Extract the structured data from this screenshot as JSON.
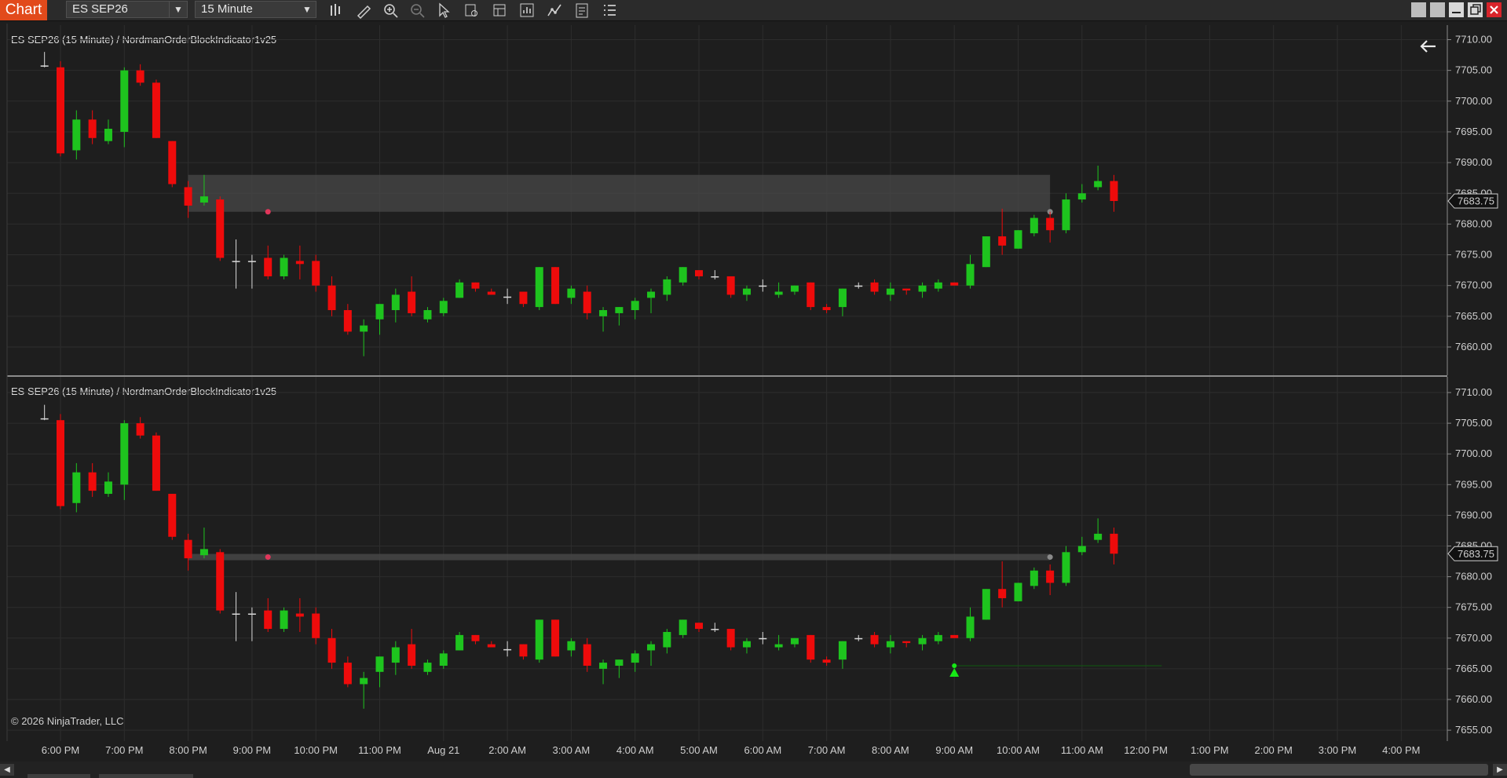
{
  "toolbar": {
    "chart_tab": "Chart",
    "instrument": "ES SEP26",
    "interval": "15 Minute",
    "tools": [
      "bar-type-icon",
      "draw-pencil-icon",
      "zoom-in-icon",
      "zoom-out-icon",
      "cursor-arrow-icon",
      "data-box-icon",
      "templates-icon",
      "strategies-icon",
      "indicators-icon",
      "properties-icon",
      "list-icon"
    ]
  },
  "window": {
    "controls": [
      "tile-icon",
      "tile-icon",
      "minimize-icon",
      "restore-icon",
      "close-icon"
    ]
  },
  "colors": {
    "up": "#1ec41e",
    "down": "#ee0b0b",
    "doji": "#d8d8d8",
    "accent": "#e24a1b",
    "zone": "#484848",
    "marker": "#e0365a",
    "signal": "#16e816"
  },
  "panels": [
    {
      "label": "ES SEP26 (15 Minute) / NordmanOrderBlockIndicator1v25",
      "last_price": "7683.75",
      "zone": {
        "kind": "box",
        "start_time": "8:00 PM",
        "end_time": "9:30 AM",
        "top": 7688.0,
        "bottom": 7682.0
      }
    },
    {
      "label": "ES SEP26 (15 Minute) / NordmanOrderBlockIndicator1v25",
      "last_price": "7683.75",
      "zone": {
        "kind": "line",
        "start_time": "8:00 PM",
        "end_time": "9:30 AM",
        "level": 7683.2
      }
    }
  ],
  "price_axis": [
    "7710.00",
    "7705.00",
    "7700.00",
    "7695.00",
    "7690.00",
    "7685.00",
    "7680.00",
    "7675.00",
    "7670.00",
    "7665.00",
    "7660.00"
  ],
  "bottom_axis_extra": "7655.00",
  "time_axis": [
    "6:00 PM",
    "7:00 PM",
    "8:00 PM",
    "9:00 PM",
    "10:00 PM",
    "11:00 PM",
    "Aug 21",
    "2:00 AM",
    "3:00 AM",
    "4:00 AM",
    "5:00 AM",
    "6:00 AM",
    "7:00 AM",
    "8:00 AM",
    "9:00 AM",
    "10:00 AM",
    "11:00 AM",
    "12:00 PM",
    "1:00 PM",
    "2:00 PM",
    "3:00 PM",
    "4:00 PM"
  ],
  "copyright": "© 2026 NinjaTrader, LLC",
  "chart_data": {
    "type": "candlestick",
    "instrument": "ES SEP26",
    "interval": "15 Minute",
    "first_bar_time": "5:45 PM",
    "ylim": [
      7657,
      7711
    ],
    "bars": [
      [
        7705.8,
        7708,
        7705.5,
        7705.8
      ],
      [
        7705.5,
        7706.5,
        7691,
        7691.5
      ],
      [
        7692,
        7698.5,
        7690.5,
        7697
      ],
      [
        7697,
        7698.5,
        7693,
        7694
      ],
      [
        7693.5,
        7697,
        7693,
        7695.5
      ],
      [
        7695,
        7705.5,
        7692.5,
        7705
      ],
      [
        7705,
        7706,
        7702.5,
        7703
      ],
      [
        7703,
        7703.5,
        7694,
        7694
      ],
      [
        7693.5,
        7693.5,
        7686,
        7686.5
      ],
      [
        7686,
        7687,
        7681,
        7683
      ],
      [
        7683.5,
        7688,
        7683,
        7684.5
      ],
      [
        7684,
        7684.5,
        7674,
        7674.5
      ],
      [
        7674,
        7677.5,
        7669.5,
        7674
      ],
      [
        7674,
        7675,
        7669.5,
        7674
      ],
      [
        7674.5,
        7676.5,
        7671,
        7671.5
      ],
      [
        7671.5,
        7675,
        7671,
        7674.5
      ],
      [
        7674,
        7676.5,
        7671,
        7673.5
      ],
      [
        7674,
        7675,
        7669,
        7670
      ],
      [
        7670,
        7671.5,
        7665,
        7666
      ],
      [
        7666,
        7667,
        7662,
        7662.5
      ],
      [
        7662.5,
        7664.5,
        7658.5,
        7663.5
      ],
      [
        7664.5,
        7667,
        7662,
        7667
      ],
      [
        7666,
        7669.5,
        7664,
        7668.5
      ],
      [
        7669,
        7671.5,
        7665,
        7665.5
      ],
      [
        7664.5,
        7666.5,
        7664,
        7666
      ],
      [
        7665.5,
        7668,
        7665,
        7667.5
      ],
      [
        7668,
        7671,
        7668,
        7670.5
      ],
      [
        7670.5,
        7670.5,
        7669,
        7669.5
      ],
      [
        7669,
        7669.5,
        7668.5,
        7668.5
      ],
      [
        7668.2,
        7669.5,
        7667,
        7668.2
      ],
      [
        7669,
        7669,
        7666.5,
        7667
      ],
      [
        7666.5,
        7673,
        7666,
        7673
      ],
      [
        7673,
        7673,
        7667,
        7667
      ],
      [
        7668,
        7670,
        7667,
        7669.5
      ],
      [
        7669,
        7670,
        7664.5,
        7665.5
      ],
      [
        7665,
        7666.5,
        7662.5,
        7666
      ],
      [
        7665.5,
        7666.5,
        7663.5,
        7666.5
      ],
      [
        7666,
        7668,
        7664.5,
        7667.5
      ],
      [
        7668,
        7669.5,
        7665.5,
        7669
      ],
      [
        7668.5,
        7671.5,
        7667.5,
        7671
      ],
      [
        7670.5,
        7673,
        7670,
        7673
      ],
      [
        7672.5,
        7672.5,
        7671,
        7671.5
      ],
      [
        7671.5,
        7672.5,
        7671,
        7671.5
      ],
      [
        7671.5,
        7671.5,
        7668,
        7668.5
      ],
      [
        7668.5,
        7670,
        7667.5,
        7669.5
      ],
      [
        7670,
        7671,
        7669,
        7670
      ],
      [
        7668.5,
        7670.5,
        7668,
        7669
      ],
      [
        7669,
        7670,
        7668.5,
        7670
      ],
      [
        7670.5,
        7670.5,
        7666,
        7666.5
      ],
      [
        7666.5,
        7667,
        7665.5,
        7666
      ],
      [
        7666.5,
        7669.5,
        7665,
        7669.5
      ],
      [
        7670,
        7670.5,
        7669.5,
        7670
      ],
      [
        7670.5,
        7671,
        7668.5,
        7669
      ],
      [
        7668.5,
        7670.5,
        7667.5,
        7669.5
      ],
      [
        7669.5,
        7669.5,
        7668.5,
        7669.2
      ],
      [
        7669,
        7670.5,
        7668,
        7670
      ],
      [
        7669.5,
        7671,
        7669,
        7670.5
      ],
      [
        7670.5,
        7670.5,
        7670,
        7670
      ],
      [
        7670,
        7675,
        7669.5,
        7673.5
      ],
      [
        7673,
        7678,
        7673,
        7678
      ],
      [
        7678,
        7682.5,
        7675,
        7676.5
      ],
      [
        7676,
        7679,
        7676,
        7679
      ],
      [
        7678.5,
        7681.5,
        7678,
        7681
      ],
      [
        7681,
        7682,
        7677,
        7679
      ],
      [
        7679,
        7685,
        7678.5,
        7684
      ],
      [
        7684,
        7686.5,
        7683.5,
        7685
      ],
      [
        7686,
        7689.5,
        7685.5,
        7687
      ],
      [
        7687,
        7688,
        7682,
        7683.75
      ]
    ],
    "signals": [
      {
        "panel": 2,
        "time": "8:00 AM",
        "price": 7665.5,
        "type": "up-arrow",
        "line_end_time": "11:15 AM"
      }
    ],
    "markers": [
      {
        "time": "9:15 PM",
        "price": 7682.5
      }
    ]
  }
}
